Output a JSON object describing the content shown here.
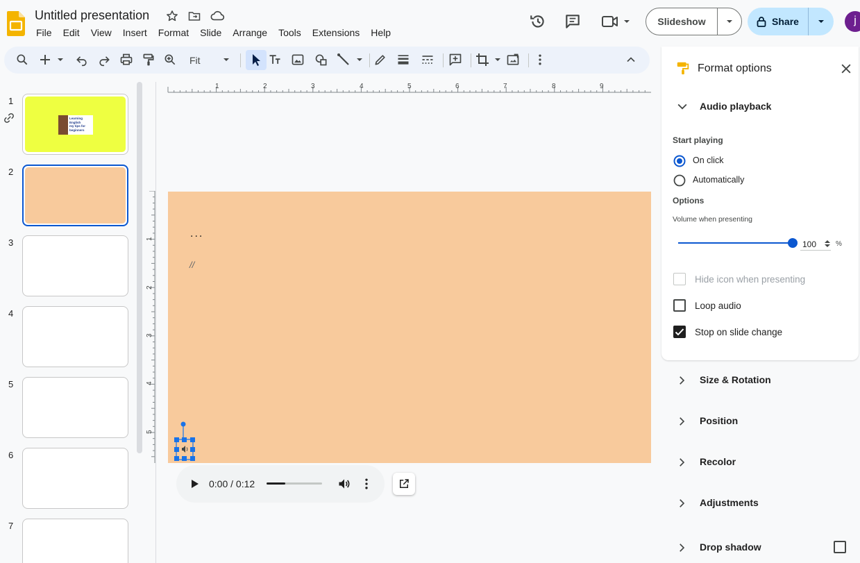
{
  "app": {
    "title": "Untitled presentation"
  },
  "menu": [
    "File",
    "Edit",
    "View",
    "Insert",
    "Format",
    "Slide",
    "Arrange",
    "Tools",
    "Extensions",
    "Help"
  ],
  "header": {
    "slideshow_label": "Slideshow",
    "share_label": "Share",
    "avatar_letter": "j"
  },
  "toolbar": {
    "zoom": "Fit"
  },
  "filmstrip": {
    "slide_numbers": [
      "1",
      "2",
      "3",
      "4",
      "5",
      "6",
      "7"
    ],
    "slide1_text": [
      "Learning English",
      "my tips for",
      "beginners"
    ]
  },
  "slide": {
    "dots": "...",
    "slashes": "//"
  },
  "audio": {
    "time": "0:00 / 0:12",
    "progress": 0.34
  },
  "panel": {
    "title": "Format options",
    "section_audio": "Audio playback",
    "start_playing": "Start playing",
    "on_click": "On click",
    "automatically": "Automatically",
    "options": "Options",
    "volume_label": "Volume when presenting",
    "volume_value": "100",
    "volume_unit": "%",
    "hide_icon": "Hide icon when presenting",
    "loop_audio": "Loop audio",
    "stop_on_change": "Stop on slide change",
    "sections": [
      "Size & Rotation",
      "Position",
      "Recolor",
      "Adjustments",
      "Drop shadow"
    ]
  },
  "colors": {
    "accent": "#0b57d0",
    "slide_bg": "#f8ca9c",
    "slide1_bg": "#eeff41",
    "share_bg": "#c2e7ff"
  }
}
